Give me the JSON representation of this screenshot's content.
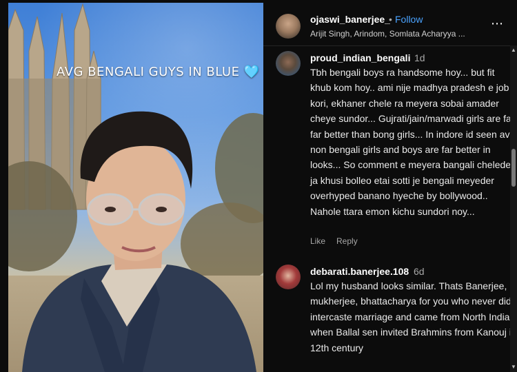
{
  "media": {
    "caption": "AVG  BENGALI GUYS IN BLUE",
    "caption_emoji": "🩵"
  },
  "header": {
    "username": "ojaswi_banerjee_",
    "separator": "•",
    "follow_label": "Follow",
    "audio_text": "Arijit Singh, Arindom, Somlata Acharyya ...",
    "more_icon": "⋯"
  },
  "comments": [
    {
      "user": "proud_indian_bengali",
      "time": "1d",
      "text": "Tbh bengali boys ra handsome hoy... but fit khub kom hoy.. ami nije madhya pradesh e job kori, ekhaner chele ra meyera sobai amader cheye sundor... Gujrati/jain/marwadi girls are far far better than bong girls... In indore id seen avg non bengali girls and boys are far better in looks... So comment e meyera bangali cheleder ja khusi bolleo etai sotti je bengali meyeder overhyped banano hyeche by bollywood.. Nahole ttara emon kichu sundori noy...",
      "like_label": "Like",
      "reply_label": "Reply"
    },
    {
      "user": "debarati.banerjee.108",
      "time": "6d",
      "text": "Lol my husband looks similar. Thats Banerjee, mukherjee, bhattacharya for you who never did intercaste marriage and came from North India when Ballal sen invited Brahmins from Kanouj in 12th century"
    }
  ],
  "scrollbar": {
    "up_icon": "▲",
    "down_icon": "▼"
  }
}
